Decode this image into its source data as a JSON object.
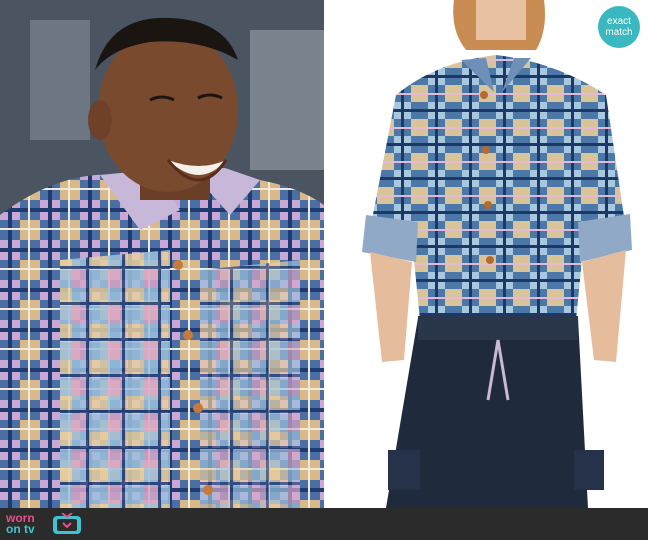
{
  "badge": {
    "line1": "exact",
    "line2": "match",
    "color": "#39b8c0"
  },
  "footer": {
    "brand_top": "worn",
    "brand_bottom": "on tv",
    "icon": "tv-icon"
  },
  "colors": {
    "accent_pink": "#e94d8a",
    "accent_teal": "#3fc4cf"
  }
}
